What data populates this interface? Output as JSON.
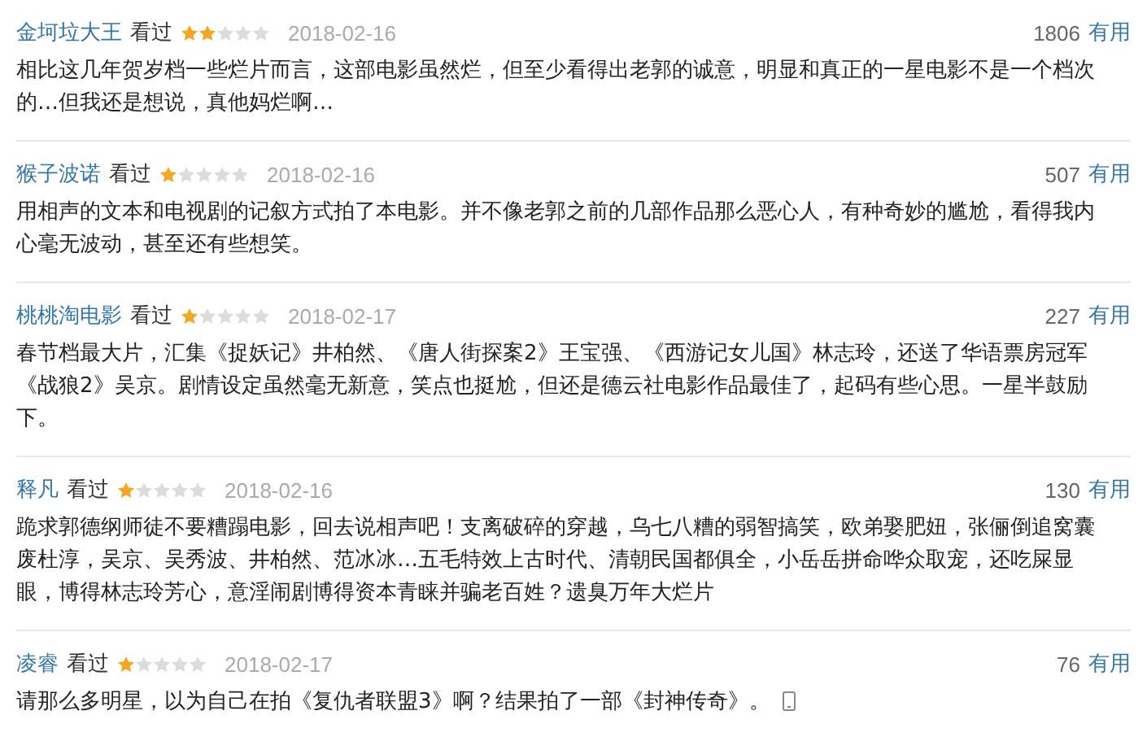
{
  "reviews": [
    {
      "user": "金坷垃大王",
      "status": "看过",
      "stars": 2,
      "date": "2018-02-16",
      "votes": "1806",
      "useful": "有用",
      "text": "相比这几年贺岁档一些烂片而言，这部电影虽然烂，但至少看得出老郭的诚意，明显和真正的一星电影不是一个档次的…但我还是想说，真他妈烂啊…",
      "mobile": false
    },
    {
      "user": "猴子波诺",
      "status": "看过",
      "stars": 1,
      "date": "2018-02-16",
      "votes": "507",
      "useful": "有用",
      "text": "用相声的文本和电视剧的记叙方式拍了本电影。并不像老郭之前的几部作品那么恶心人，有种奇妙的尴尬，看得我内心毫无波动，甚至还有些想笑。",
      "mobile": false
    },
    {
      "user": "桃桃淘电影",
      "status": "看过",
      "stars": 1,
      "date": "2018-02-17",
      "votes": "227",
      "useful": "有用",
      "text": "春节档最大片，汇集《捉妖记》井柏然、《唐人街探案2》王宝强、《西游记女儿国》林志玲，还送了华语票房冠军《战狼2》吴京。剧情设定虽然毫无新意，笑点也挺尬，但还是德云社电影作品最佳了，起码有些心思。一星半鼓励下。",
      "mobile": false
    },
    {
      "user": "释凡",
      "status": "看过",
      "stars": 1,
      "date": "2018-02-16",
      "votes": "130",
      "useful": "有用",
      "text": "跪求郭德纲师徒不要糟蹋电影，回去说相声吧！支离破碎的穿越，乌七八糟的弱智搞笑，欧弟娶肥妞，张俪倒追窝囊废杜淳，吴京、吴秀波、井柏然、范冰冰…五毛特效上古时代、清朝民国都俱全，小岳岳拼命哗众取宠，还吃屎显眼，博得林志玲芳心，意淫闹剧博得资本青睐并骗老百姓？遗臭万年大烂片",
      "mobile": false
    },
    {
      "user": "凌睿",
      "status": "看过",
      "stars": 1,
      "date": "2018-02-17",
      "votes": "76",
      "useful": "有用",
      "text": "请那么多明星，以为自己在拍《复仇者联盟3》啊？结果拍了一部《封神传奇》。",
      "mobile": true
    }
  ]
}
